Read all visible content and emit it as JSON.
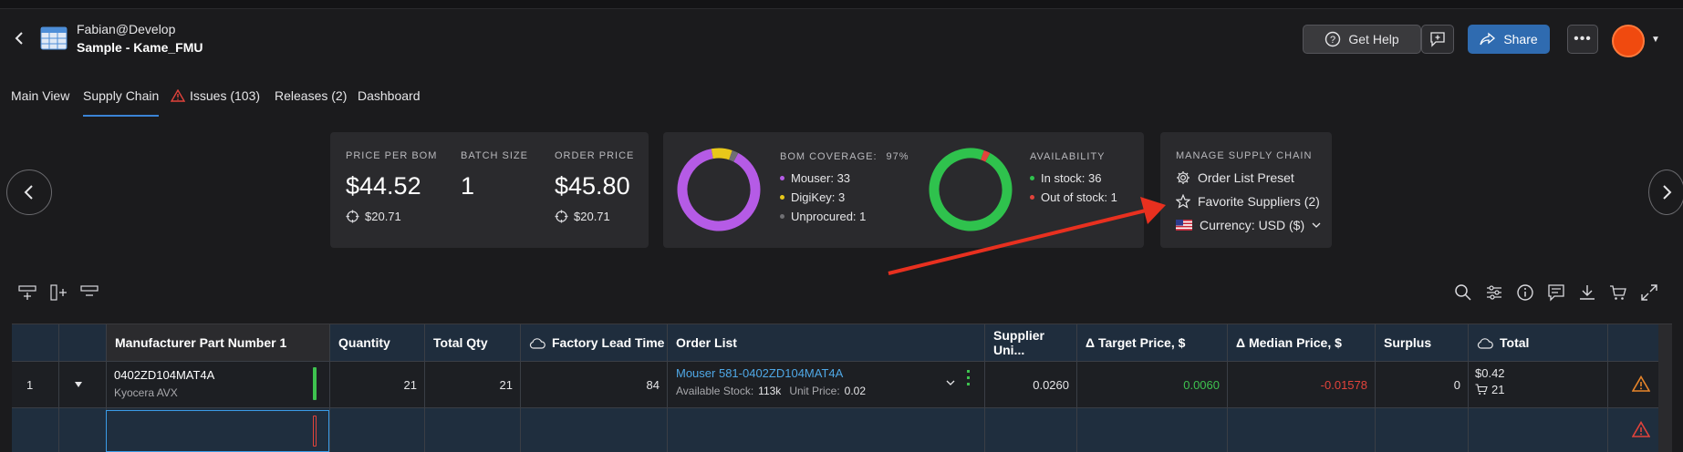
{
  "header": {
    "user": "Fabian@Develop",
    "project": "Sample - Kame_FMU",
    "get_help": "Get Help",
    "share": "Share",
    "more": "•••"
  },
  "tabs": [
    {
      "label": "Main View"
    },
    {
      "label": "Supply Chain"
    },
    {
      "label": "Issues (103)"
    },
    {
      "label": "Releases (2)"
    },
    {
      "label": "Dashboard"
    }
  ],
  "summary": {
    "price_per_bom_label": "PRICE PER BOM",
    "price_per_bom": "$44.52",
    "price_per_bom_target": "$20.71",
    "batch_size_label": "BATCH SIZE",
    "batch_size": "1",
    "order_price_label": "ORDER PRICE",
    "order_price": "$45.80",
    "order_price_target": "$20.71"
  },
  "coverage": {
    "label": "BOM COVERAGE:",
    "percent": "97%",
    "items": [
      {
        "label": "Mouser: 33",
        "value": 33,
        "color": "#b55be6"
      },
      {
        "label": "DigiKey: 3",
        "value": 3,
        "color": "#e8c81a"
      },
      {
        "label": "Unprocured: 1",
        "value": 1,
        "color": "#6f6f73"
      }
    ]
  },
  "availability": {
    "label": "AVAILABILITY",
    "items": [
      {
        "label": "In stock: 36",
        "value": 36,
        "color": "#2fc24d"
      },
      {
        "label": "Out of stock: 1",
        "value": 1,
        "color": "#e2433b"
      }
    ]
  },
  "manage": {
    "label": "MANAGE SUPPLY CHAIN",
    "order_list_preset": "Order List Preset",
    "favorite_suppliers": "Favorite Suppliers (2)",
    "currency": "Currency: USD ($)"
  },
  "table": {
    "headers": {
      "mpn": "Manufacturer Part Number 1",
      "quantity": "Quantity",
      "total_qty": "Total Qty",
      "lead_time": "Factory Lead Time",
      "order_list": "Order List",
      "supplier_unit": "Supplier Uni...",
      "target_price": "Δ Target Price, $",
      "median_price": "Δ Median Price, $",
      "surplus": "Surplus",
      "total": "Total"
    },
    "row1": {
      "index": "1",
      "mpn": "0402ZD104MAT4A",
      "manufacturer": "Kyocera AVX",
      "quantity": "21",
      "total_qty": "21",
      "lead_time": "84",
      "order_link": "Mouser 581-0402ZD104MAT4A",
      "available_label": "Available Stock:",
      "available_value": "113k",
      "unit_price_label": "Unit Price:",
      "unit_price_value": "0.02",
      "supplier_unit": "0.0260",
      "target_price": "0.0060",
      "median_price": "-0.01578",
      "surplus": "0",
      "total_price": "$0.42",
      "total_cart": "21"
    }
  },
  "colors": {
    "accent": "#3a84d6",
    "share": "#2f6bb0",
    "positive": "#3ec24f",
    "negative": "#e2433b",
    "warning": "#e8852a",
    "arrow": "#e8301f"
  }
}
